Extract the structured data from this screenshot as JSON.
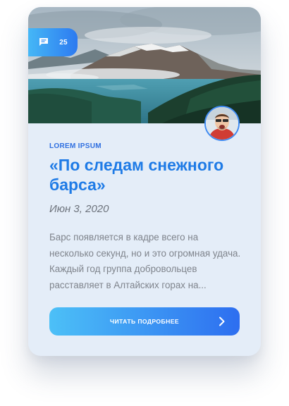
{
  "card": {
    "comment_count": "25",
    "category": "LOREM IPSUM",
    "title": "«По следам снежного барса»",
    "date": "Июн 3, 2020",
    "excerpt": "Барс появляется в кадре всего на несколько секунд, но и это  огромная удача. Каждый год группа добровольцев расставляет в Алтайских горах на...",
    "cta_label": "ЧИТАТЬ ПОДРОБНЕЕ"
  },
  "icons": {
    "comments": "chat-bubble-icon",
    "cta": "chevron-right-icon"
  },
  "colors": {
    "accent": "#1f7be6",
    "card_bg": "#e4edf8",
    "gradient_start": "#4cc0f7",
    "gradient_end": "#2d6ef0"
  }
}
